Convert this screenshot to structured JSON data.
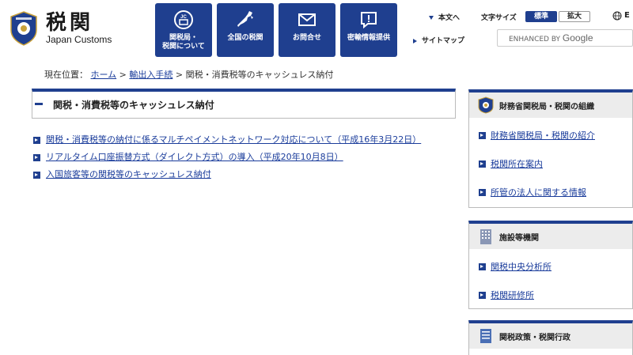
{
  "header": {
    "site_title": "税関",
    "site_subtitle": "Japan Customs",
    "nav": [
      {
        "label": "関税局・\n税関について",
        "icon": "jc-badge-icon"
      },
      {
        "label": "全国の税関",
        "icon": "japan-map-icon"
      },
      {
        "label": "お問合せ",
        "icon": "mail-icon"
      },
      {
        "label": "密輸情報提供",
        "icon": "speech-bubble-icon"
      }
    ],
    "utility": {
      "text_label": "本文へ",
      "font_size_label": "文字サイズ",
      "size_standard": "標準",
      "size_large": "拡大",
      "language": "E",
      "sitemap_label": "サイトマップ"
    },
    "search": {
      "enhanced_by": "ENHANCED BY",
      "google": "Google"
    }
  },
  "breadcrumb": {
    "prefix": "現在位置：",
    "home": "ホーム",
    "sep": ">",
    "parent": "輸出入手続",
    "current": "関税・消費税等のキャッシュレス納付"
  },
  "main": {
    "title": "関税・消費税等のキャッシュレス納付",
    "links": [
      "関税・消費税等の納付に係るマルチペイメントネットワーク対応について（平成16年3月22日）",
      "リアルタイム口座振替方式（ダイレクト方式）の導入（平成20年10月8日）",
      "入国旅客等の関税等のキャッシュレス納付"
    ]
  },
  "sidebar": {
    "boxes": [
      {
        "title": "財務省関税局・税関の組織",
        "icon": "customs-emblem-icon",
        "items": [
          "財務省関税局・税関の紹介",
          "税関所在案内",
          "所管の法人に関する情報"
        ]
      },
      {
        "title": "施設等機関",
        "icon": "building-icon",
        "items": [
          "関税中央分析所",
          "税関研修所"
        ]
      },
      {
        "title": "関税政策・税関行政",
        "icon": "document-icon",
        "items": []
      }
    ]
  },
  "colors": {
    "brand_navy": "#1f3f8f",
    "link": "#1a3c9b"
  }
}
